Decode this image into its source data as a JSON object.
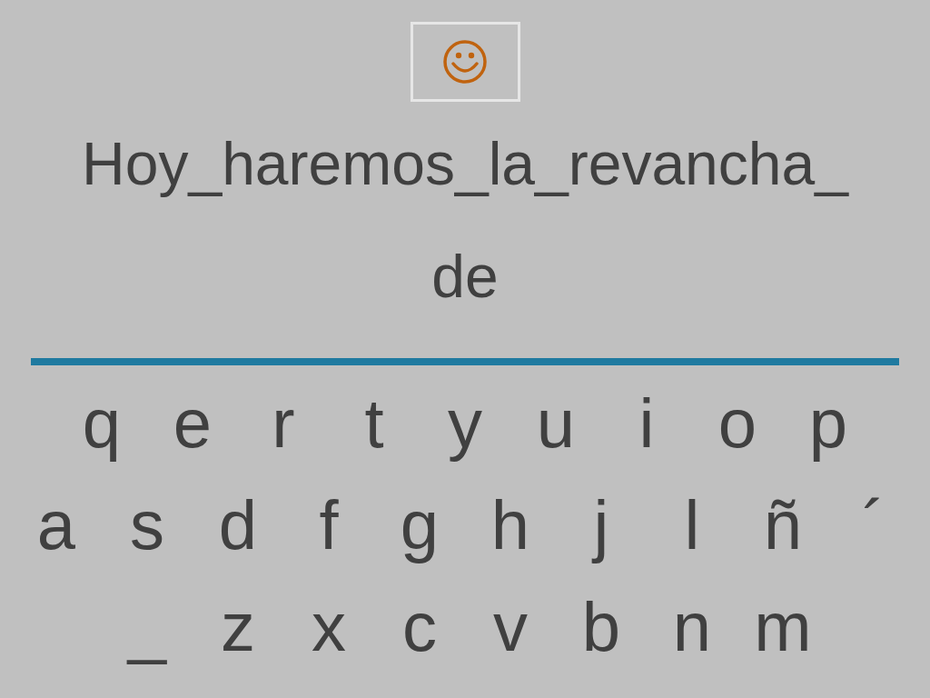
{
  "sentence_lines": [
    "Hoy_haremos_la_revancha_",
    "de"
  ],
  "keyboard_rows": [
    [
      "q",
      "e",
      "r",
      "t",
      "y",
      "u",
      "i",
      "o",
      "p"
    ],
    [
      "a",
      "s",
      "d",
      "f",
      "g",
      "h",
      "j",
      "l",
      "ñ",
      "´"
    ],
    [
      "_",
      "z",
      "x",
      "c",
      "v",
      "b",
      "n",
      "m"
    ]
  ]
}
